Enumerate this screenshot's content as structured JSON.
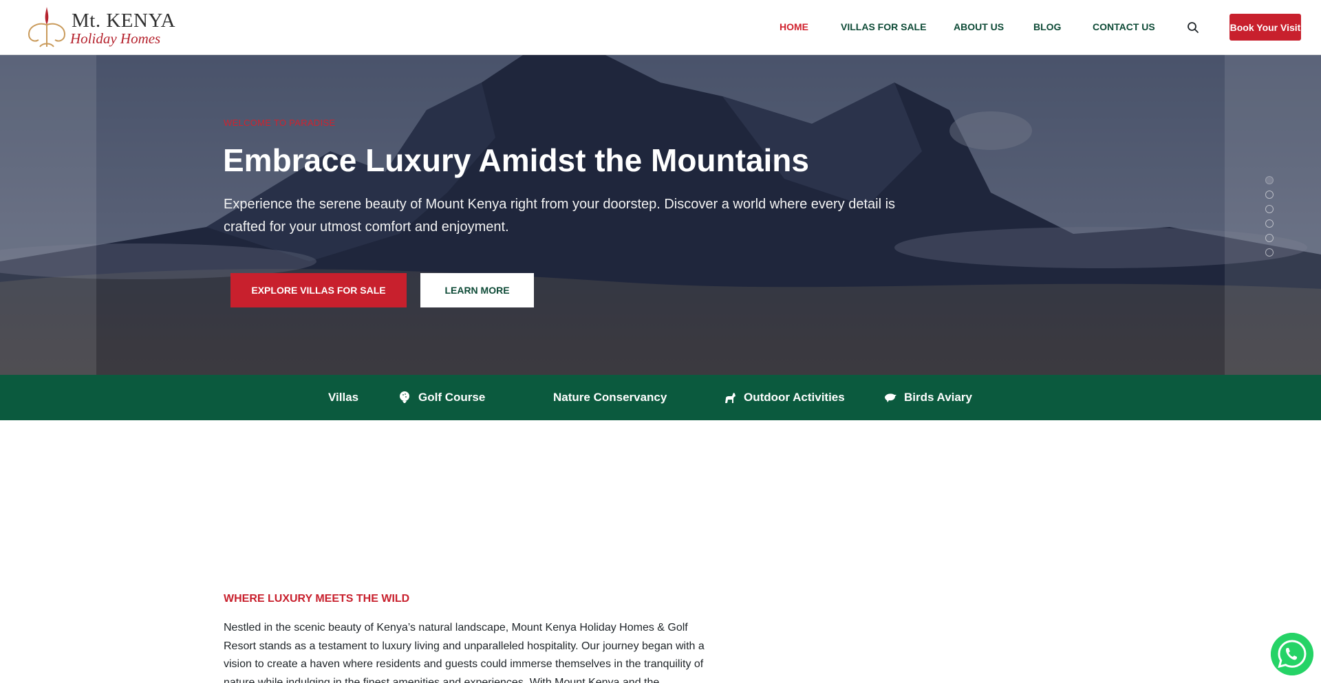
{
  "brand": {
    "name": "Mt. KENYA",
    "sub": "Holiday Homes"
  },
  "nav": {
    "items": [
      {
        "label": "HOME",
        "active": true
      },
      {
        "label": "VILLAS FOR SALE"
      },
      {
        "label": "ABOUT US"
      },
      {
        "label": "BLOG"
      },
      {
        "label": "CONTACT US"
      }
    ],
    "book_label": "Book Your Visit"
  },
  "hero": {
    "eyebrow": "WELCOME TO PARADISE",
    "title": "Embrace Luxury Amidst the Mountains",
    "text": "Experience the serene beauty of Mount Kenya right from your doorstep. Discover a world where every detail is crafted for your utmost comfort and enjoyment.",
    "primary_cta": "EXPLORE VILLAS FOR SALE",
    "secondary_cta": "LEARN MORE",
    "slides": 6,
    "active_slide": 1
  },
  "features": [
    {
      "label": "Villas",
      "icon": "none"
    },
    {
      "label": "Golf Course",
      "icon": "golf-ball-icon"
    },
    {
      "label": "Nature Conservancy",
      "icon": "none"
    },
    {
      "label": "Outdoor Activities",
      "icon": "horse-icon"
    },
    {
      "label": "Birds Aviary",
      "icon": "bird-icon"
    }
  ],
  "about": {
    "eyebrow": "WHERE LUXURY MEETS THE WILD",
    "text": "Nestled in the scenic beauty of Kenya’s natural landscape, Mount Kenya Holiday Homes & Golf Resort stands as a testament to luxury living and unparalleled hospitality. Our journey began with a vision to create a haven where residents and guests could immerse themselves in the tranquility of nature while indulging in the finest amenities and experiences. With Mount Kenya and the"
  },
  "colors": {
    "accent_red": "#c8202d",
    "brand_green": "#0b5a3e",
    "nav_green": "#0d4a36",
    "whatsapp_green": "#25d366"
  }
}
